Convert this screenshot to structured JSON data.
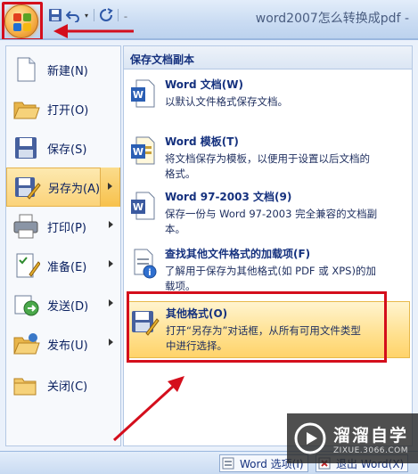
{
  "window": {
    "title": "word2007怎么转换成pdf -"
  },
  "quick_access": {
    "icons": [
      "save-icon",
      "undo-icon",
      "redo-icon",
      "customize-icon"
    ],
    "undo_dropdown": "▾",
    "customize_label": "₌"
  },
  "left_menu": {
    "items": [
      {
        "label": "新建(N)",
        "icon": "new-document-icon",
        "arrow": false,
        "selected": false
      },
      {
        "label": "打开(O)",
        "icon": "open-folder-icon",
        "arrow": false,
        "selected": false
      },
      {
        "label": "保存(S)",
        "icon": "save-disk-icon",
        "arrow": false,
        "selected": false
      },
      {
        "label": "另存为(A)",
        "icon": "save-as-icon",
        "arrow": true,
        "selected": true
      },
      {
        "label": "打印(P)",
        "icon": "printer-icon",
        "arrow": true,
        "selected": false
      },
      {
        "label": "准备(E)",
        "icon": "prepare-icon",
        "arrow": true,
        "selected": false
      },
      {
        "label": "发送(D)",
        "icon": "send-icon",
        "arrow": true,
        "selected": false
      },
      {
        "label": "发布(U)",
        "icon": "publish-icon",
        "arrow": true,
        "selected": false
      },
      {
        "label": "关闭(C)",
        "icon": "close-folder-icon",
        "arrow": false,
        "selected": false
      }
    ]
  },
  "right_panel": {
    "header": "保存文档副本",
    "items": [
      {
        "title": "Word 文档(W)",
        "desc": [
          "以默认文件格式保存文档。"
        ],
        "icon": "word-document-icon",
        "selected": false
      },
      {
        "title": "Word 模板(T)",
        "desc": [
          "将文档保存为模板，以便用于设置以后文档的",
          "格式。"
        ],
        "icon": "word-template-icon",
        "selected": false
      },
      {
        "title": "Word 97-2003 文档(9)",
        "desc": [
          "保存一份与 Word 97-2003 完全兼容的文档副",
          "本。"
        ],
        "icon": "word-97-2003-icon",
        "selected": false
      },
      {
        "title": "查找其他文件格式的加载项(F)",
        "desc": [
          "了解用于保存为其他格式(如 PDF 或 XPS)的加",
          "载项。"
        ],
        "icon": "addins-info-icon",
        "selected": false
      },
      {
        "title": "其他格式(O)",
        "desc": [
          "打开“另存为”对话框，从所有可用文件类型",
          "中进行选择。"
        ],
        "icon": "other-formats-icon",
        "selected": true
      }
    ]
  },
  "bottom_bar": {
    "options_label": "Word 选项(I)",
    "exit_label": "退出 Word(X)"
  },
  "watermark": {
    "brand": "溜溜自学",
    "site": "ZIXUE.3066.COM"
  },
  "colors": {
    "highlight_red": "#d40e1c",
    "selection_gold": "#fbd37a",
    "text_navy": "#15317e"
  }
}
